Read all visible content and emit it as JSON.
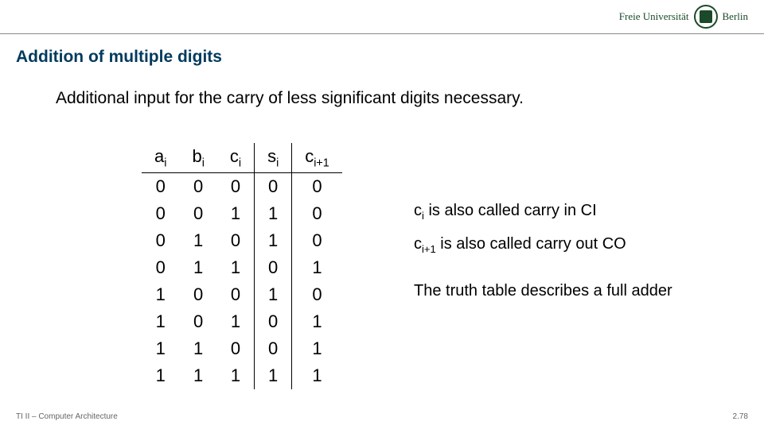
{
  "logo": {
    "text_left": "Freie Universität",
    "text_right": "Berlin"
  },
  "title": "Addition of multiple digits",
  "subtitle": "Additional input for the carry of less significant digits necessary.",
  "notes": {
    "ci_label": "c",
    "ci_sub": "i",
    "ci_rest": " is also called carry in CI",
    "co_label": "c",
    "co_sub": "i+1",
    "co_rest": " is also called carry out CO",
    "third": "The truth table describes a full adder"
  },
  "footer": {
    "left": "TI II – Computer Architecture",
    "right": "2.78"
  },
  "chart_data": {
    "type": "table",
    "title": "Full adder truth table",
    "columns": [
      {
        "var": "a",
        "sub": "i"
      },
      {
        "var": "b",
        "sub": "i"
      },
      {
        "var": "c",
        "sub": "i"
      },
      {
        "var": "s",
        "sub": "i"
      },
      {
        "var": "c",
        "sub": "i+1"
      }
    ],
    "rows": [
      [
        0,
        0,
        0,
        0,
        0
      ],
      [
        0,
        0,
        1,
        1,
        0
      ],
      [
        0,
        1,
        0,
        1,
        0
      ],
      [
        0,
        1,
        1,
        0,
        1
      ],
      [
        1,
        0,
        0,
        1,
        0
      ],
      [
        1,
        0,
        1,
        0,
        1
      ],
      [
        1,
        1,
        0,
        0,
        1
      ],
      [
        1,
        1,
        1,
        1,
        1
      ]
    ]
  }
}
